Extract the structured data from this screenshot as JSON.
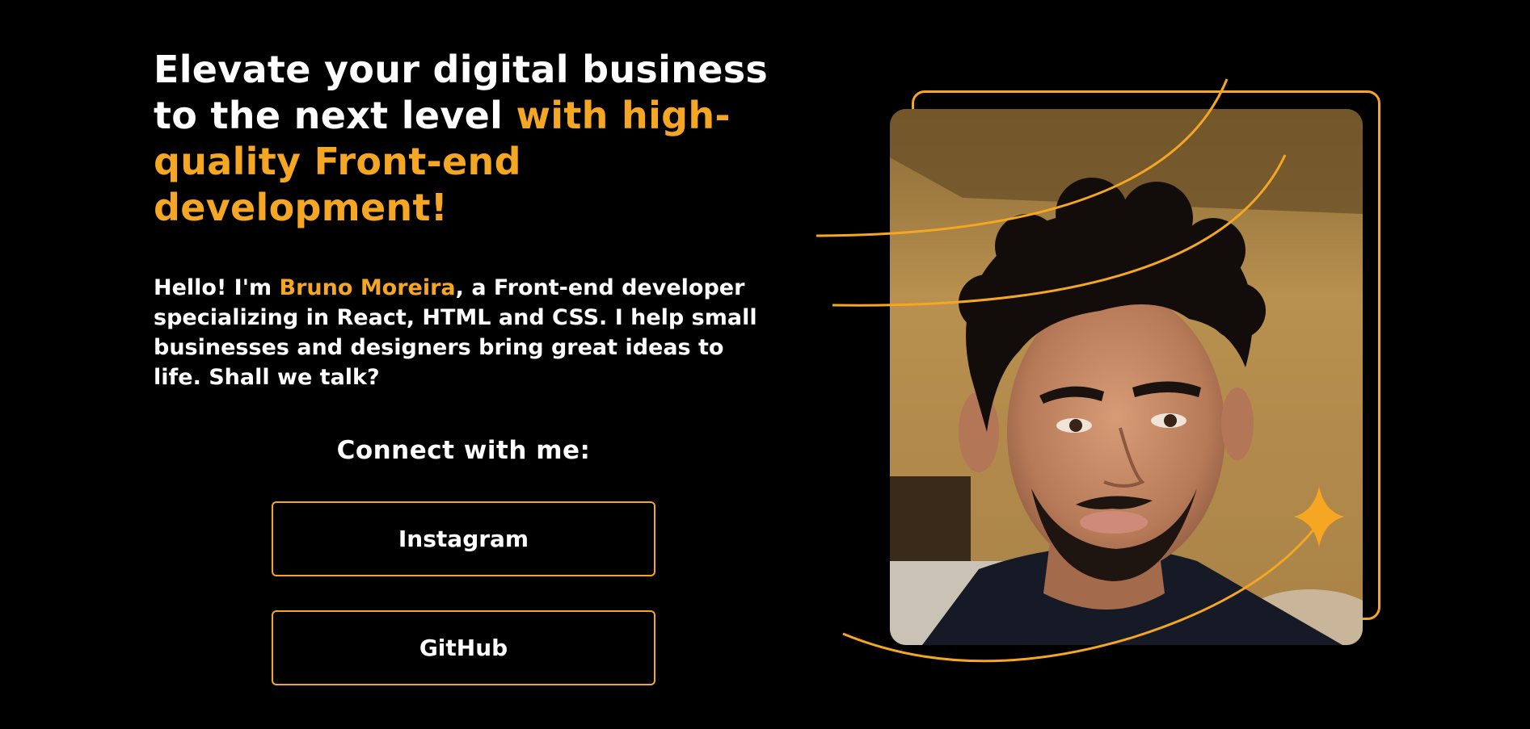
{
  "hero": {
    "headline_part1": "Elevate your digital business to the next level ",
    "headline_accent": "with high-quality Front-end development!",
    "intro_before": "Hello! I'm ",
    "intro_name": "Bruno Moreira",
    "intro_after": ", a Front-end developer specializing in React, HTML and CSS. I help small businesses and designers bring great ideas to life. Shall we talk?"
  },
  "connect": {
    "title": "Connect with me:",
    "buttons": [
      {
        "label": "Instagram"
      },
      {
        "label": "GitHub"
      }
    ]
  },
  "colors": {
    "background": "#000000",
    "accent": "#f5a623",
    "text": "#ffffff"
  },
  "icons": {
    "sparkle": "four-point-star-icon"
  }
}
